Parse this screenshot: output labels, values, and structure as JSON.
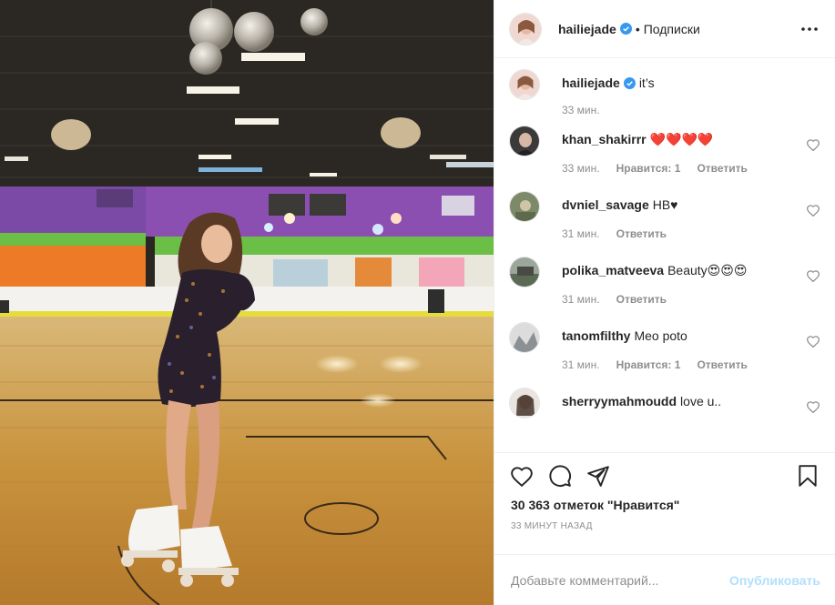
{
  "post": {
    "author": "hailiejade",
    "separator": "•",
    "follow_status": "Подписки",
    "caption": "it’s",
    "caption_time": "33 мин."
  },
  "comments": [
    {
      "username": "khan_shakirrr",
      "text": "❤️❤️❤️❤️",
      "time": "33 мин.",
      "likes_label": "Нравится: 1",
      "reply_label": "Ответить",
      "avatar_color": "#3a3a3a"
    },
    {
      "username": "dvniel_savage",
      "text": "HB♥",
      "time": "31 мин.",
      "likes_label": "",
      "reply_label": "Ответить",
      "avatar_color": "#7d8a6a"
    },
    {
      "username": "polika_matveeva",
      "text": "Beauty😍😍😍",
      "time": "31 мин.",
      "likes_label": "",
      "reply_label": "Ответить",
      "avatar_color": "#5b6a55"
    },
    {
      "username": "tanomfilthy",
      "text": "Meo poto",
      "time": "31 мин.",
      "likes_label": "Нравится: 1",
      "reply_label": "Ответить",
      "avatar_color": "#9aa0a4"
    },
    {
      "username": "sherryymahmoudd",
      "text": "love u..",
      "time": "",
      "likes_label": "",
      "reply_label": "",
      "avatar_color": "#6b5a55"
    }
  ],
  "stats": {
    "likes": "30 363 отметок \"Нравится\"",
    "posted_ago": "33 МИНУТ НАЗАД"
  },
  "comment_box": {
    "placeholder": "Добавьте комментарий...",
    "publish_label": "Опубликовать"
  },
  "colors": {
    "verified": "#3897f0",
    "publish_disabled": "#b2dffc",
    "meta_gray": "#8e8e8e"
  },
  "icons": [
    "more-options-icon",
    "verified-badge-icon",
    "heart-icon",
    "comment-icon",
    "share-icon",
    "bookmark-icon"
  ]
}
